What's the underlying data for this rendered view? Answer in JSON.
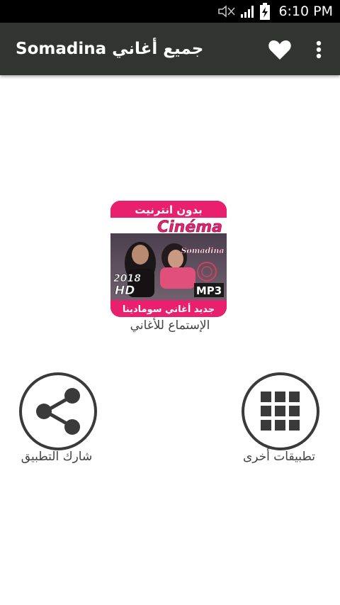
{
  "status_bar": {
    "time": "6:10 PM",
    "icons": [
      "mute-icon",
      "signal-icon",
      "battery-charging-icon"
    ]
  },
  "app_bar": {
    "title": "Somadina جميع أغاني",
    "actions": [
      "favorite-heart-icon",
      "overflow-menu-icon"
    ]
  },
  "featured_app": {
    "label": "الإستماع للأغاني",
    "icon_text": {
      "top_banner": "بدون انترنيت",
      "heading": "Cinéma",
      "brand": "Somadina",
      "year": "2018",
      "quality": "HD",
      "format": "MP3",
      "bottom_banner": "جديد أغاني سومادينا"
    }
  },
  "share_action": {
    "label": "شارك التطبيق",
    "icon": "share-icon"
  },
  "more_apps_action": {
    "label": "تطبيقات أخرى",
    "icon": "grid-apps-icon"
  },
  "colors": {
    "status_bar": "#000000",
    "app_bar": "#323432",
    "tile_pink": "#e8206e",
    "circle_border": "#3a3a3a"
  }
}
